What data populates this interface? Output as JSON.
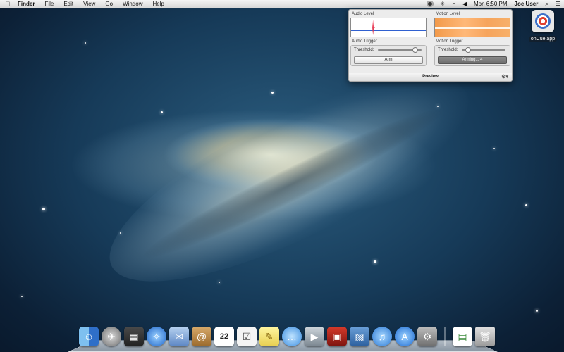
{
  "menubar": {
    "apple_icon": "apple-icon",
    "app_name": "Finder",
    "menus": [
      "File",
      "Edit",
      "View",
      "Go",
      "Window",
      "Help"
    ],
    "clock": "Mon 6:50 PM",
    "user": "Joe User",
    "status_icons": [
      "oncue-camera-icon",
      "bluetooth-icon",
      "wifi-icon",
      "volume-icon",
      "search-icon",
      "list-icon"
    ]
  },
  "desktop_icon": {
    "label": "onCue.app",
    "icon": "oncue-target-icon"
  },
  "panel": {
    "audio_level_title": "Audio Level",
    "motion_level_title": "Motion Level",
    "audio_trigger_title": "Audio Trigger",
    "motion_trigger_title": "Motion Trigger",
    "threshold_label": "Threshold:",
    "audio_threshold": 0.85,
    "motion_threshold": 0.15,
    "arm_button": "Arm",
    "arming_button": "Arming... 4",
    "footer_title": "Preview",
    "colors": {
      "audio_line": "#3060d0",
      "audio_spike": "#d0203a",
      "motion_fill": "#f29a4a"
    }
  },
  "dock": {
    "apps": [
      "Finder",
      "Launchpad",
      "Mission Control",
      "Safari",
      "Mail",
      "Contacts",
      "Calendar",
      "Reminders",
      "Notes",
      "Messages",
      "FaceTime",
      "Photo Booth",
      "iPhoto",
      "iTunes",
      "App Store",
      "System Preferences",
      "Document",
      "Trash"
    ],
    "calendar_day": "22"
  }
}
